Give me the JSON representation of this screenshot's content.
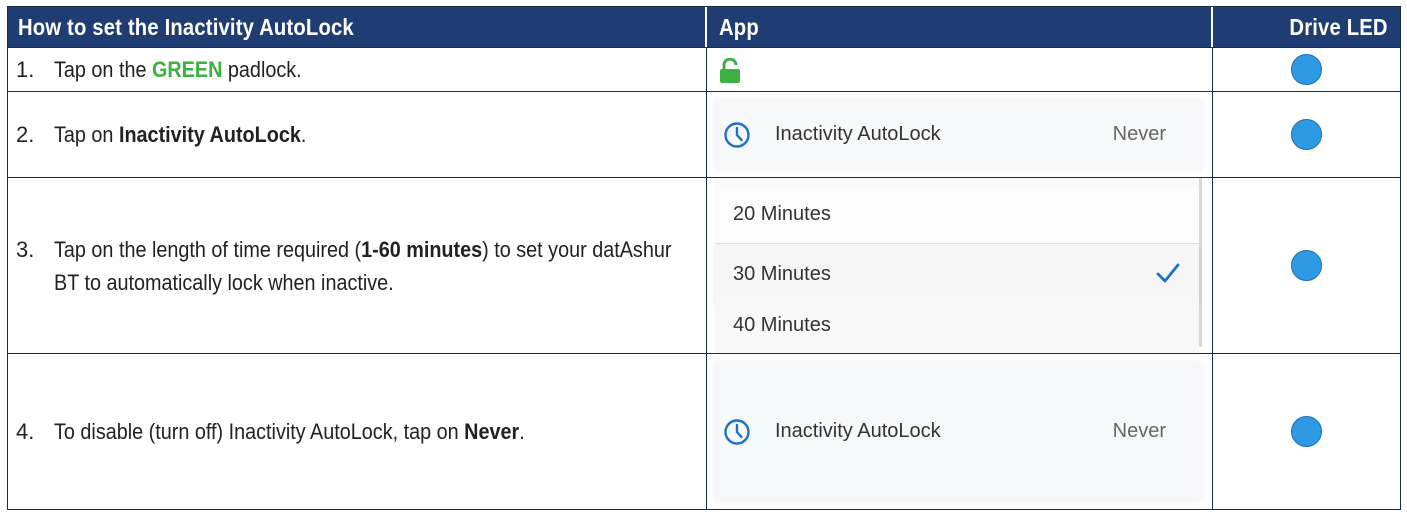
{
  "header": {
    "instructions": "How to set the Inactivity AutoLock",
    "app": "App",
    "drive_led": "Drive LED"
  },
  "steps": [
    {
      "num": "1.",
      "pre": "Tap on the ",
      "bold": "GREEN",
      "post": " padlock."
    },
    {
      "num": "2.",
      "pre": "Tap on ",
      "bold": "Inactivity AutoLock",
      "post": "."
    },
    {
      "num": "3.",
      "pre": "Tap on the length of time required (",
      "bold": "1-60 minutes",
      "post": ") to set your datAshur BT to automatically lock when inactive."
    },
    {
      "num": "4.",
      "pre": "To disable (turn off) Inactivity AutoLock, tap on ",
      "bold": "Never",
      "post": "."
    }
  ],
  "app": {
    "setting_label": "Inactivity AutoLock",
    "setting_value": "Never",
    "options": [
      "20 Minutes",
      "30 Minutes",
      "40 Minutes"
    ],
    "selected_option": "30 Minutes"
  },
  "colors": {
    "header_bg": "#1f3d73",
    "led_blue": "#2e9ae6",
    "padlock_green": "#3cb043",
    "accent_blue": "#1a73c8"
  },
  "icons": {
    "padlock": "padlock-open-icon",
    "clock": "clock-icon",
    "check": "checkmark-icon",
    "led": "led-indicator-icon"
  }
}
